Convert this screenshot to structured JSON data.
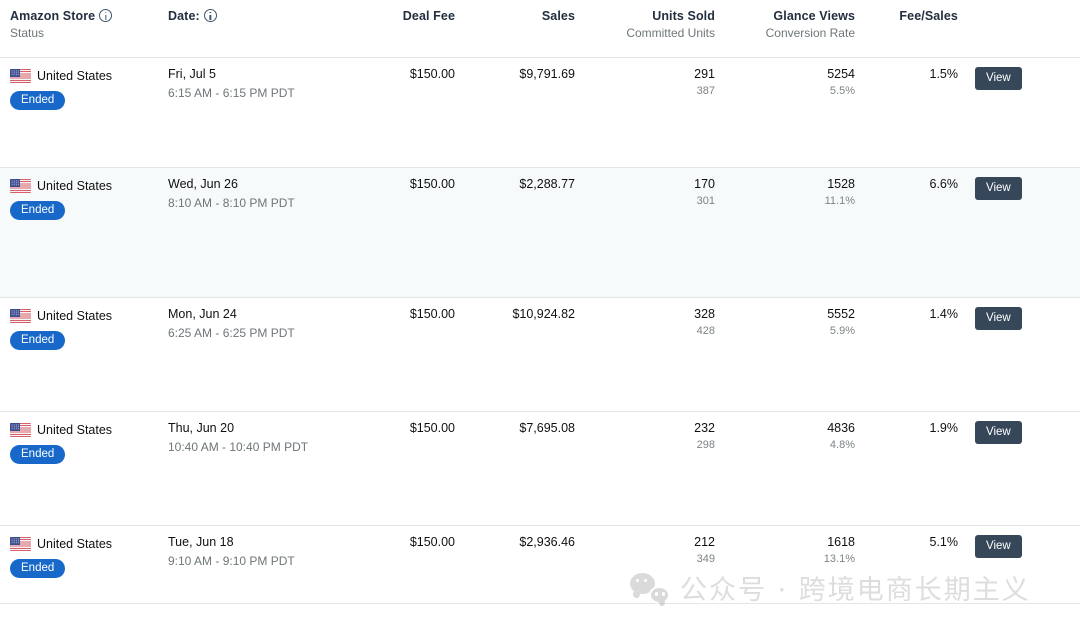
{
  "header": {
    "columns": [
      {
        "main": "Amazon Store",
        "sub": "Status",
        "info": true,
        "align": "left"
      },
      {
        "main": "Date:",
        "sub": "",
        "info": true,
        "align": "left"
      },
      {
        "main": "Deal Fee",
        "sub": "",
        "info": false,
        "align": "right"
      },
      {
        "main": "Sales",
        "sub": "",
        "info": false,
        "align": "right"
      },
      {
        "main": "Units Sold",
        "sub": "Committed Units",
        "info": false,
        "align": "right"
      },
      {
        "main": "Glance Views",
        "sub": "Conversion Rate",
        "info": false,
        "align": "right"
      },
      {
        "main": "Fee/Sales",
        "sub": "",
        "info": false,
        "align": "right"
      }
    ]
  },
  "rows": [
    {
      "store": "United States",
      "status": "Ended",
      "date": "Fri, Jul 5",
      "time": "6:15 AM - 6:15 PM PDT",
      "deal_fee": "$150.00",
      "sales": "$9,791.69",
      "units_sold": "291",
      "committed_units": "387",
      "glance_views": "5254",
      "conversion_rate": "5.5%",
      "fee_sales": "1.5%",
      "action": "View",
      "tinted": false
    },
    {
      "store": "United States",
      "status": "Ended",
      "date": "Wed, Jun 26",
      "time": "8:10 AM - 8:10 PM PDT",
      "deal_fee": "$150.00",
      "sales": "$2,288.77",
      "units_sold": "170",
      "committed_units": "301",
      "glance_views": "1528",
      "conversion_rate": "11.1%",
      "fee_sales": "6.6%",
      "action": "View",
      "tinted": true
    },
    {
      "store": "United States",
      "status": "Ended",
      "date": "Mon, Jun 24",
      "time": "6:25 AM - 6:25 PM PDT",
      "deal_fee": "$150.00",
      "sales": "$10,924.82",
      "units_sold": "328",
      "committed_units": "428",
      "glance_views": "5552",
      "conversion_rate": "5.9%",
      "fee_sales": "1.4%",
      "action": "View",
      "tinted": false
    },
    {
      "store": "United States",
      "status": "Ended",
      "date": "Thu, Jun 20",
      "time": "10:40 AM - 10:40 PM PDT",
      "deal_fee": "$150.00",
      "sales": "$7,695.08",
      "units_sold": "232",
      "committed_units": "298",
      "glance_views": "4836",
      "conversion_rate": "4.8%",
      "fee_sales": "1.9%",
      "action": "View",
      "tinted": false
    },
    {
      "store": "United States",
      "status": "Ended",
      "date": "Tue, Jun 18",
      "time": "9:10 AM - 9:10 PM PDT",
      "deal_fee": "$150.00",
      "sales": "$2,936.46",
      "units_sold": "212",
      "committed_units": "349",
      "glance_views": "1618",
      "conversion_rate": "13.1%",
      "fee_sales": "5.1%",
      "action": "View",
      "tinted": false
    }
  ],
  "watermark": {
    "text": "公众号 · 跨境电商长期主义",
    "icon": "wechat-icon"
  }
}
